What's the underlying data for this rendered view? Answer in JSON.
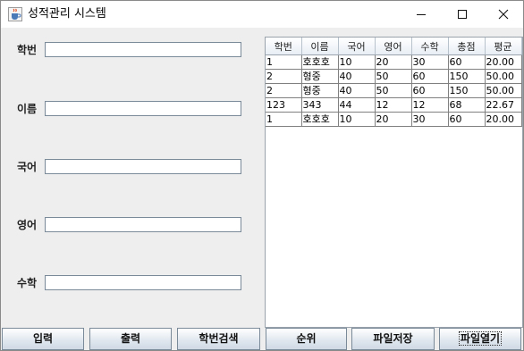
{
  "window": {
    "title": "성적관리 시스템"
  },
  "form": {
    "fields": [
      {
        "label": "학번",
        "value": ""
      },
      {
        "label": "이름",
        "value": ""
      },
      {
        "label": "국어",
        "value": ""
      },
      {
        "label": "영어",
        "value": ""
      },
      {
        "label": "수학",
        "value": ""
      }
    ]
  },
  "table": {
    "columns": [
      "학번",
      "이름",
      "국어",
      "영어",
      "수학",
      "총점",
      "평균"
    ],
    "rows": [
      [
        "1",
        "호호호",
        "10",
        "20",
        "30",
        "60",
        "20.00"
      ],
      [
        "2",
        "형중",
        "40",
        "50",
        "60",
        "150",
        "50.00"
      ],
      [
        "2",
        "형중",
        "40",
        "50",
        "60",
        "150",
        "50.00"
      ],
      [
        "123",
        "343",
        "44",
        "12",
        "12",
        "68",
        "22.67"
      ],
      [
        "1",
        "호호호",
        "10",
        "20",
        "30",
        "60",
        "20.00"
      ]
    ]
  },
  "buttons": {
    "input": "입력",
    "output": "출력",
    "search": "학번검색",
    "rank": "순위",
    "save": "파일저장",
    "open": "파일열기"
  },
  "icons": {
    "app": "java-cup-icon",
    "minimize": "minimize-icon",
    "maximize": "maximize-icon",
    "close": "close-icon"
  }
}
